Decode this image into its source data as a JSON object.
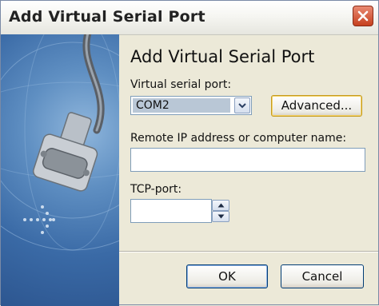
{
  "window": {
    "title": "Add Virtual Serial Port"
  },
  "dialog": {
    "heading": "Add Virtual Serial Port",
    "virtual_port_label": "Virtual serial port:",
    "virtual_port_value": "COM2",
    "advanced_button": "Advanced...",
    "remote_label": "Remote IP address or computer name:",
    "remote_value": "",
    "tcp_label": "TCP-port:",
    "tcp_value": "",
    "ok_button": "OK",
    "cancel_button": "Cancel"
  },
  "icons": {
    "close": "close-icon",
    "dropdown": "chevron-down-icon",
    "spin_up": "spin-up-icon",
    "spin_down": "spin-down-icon"
  },
  "colors": {
    "close_button": "#d55a3a",
    "banner_blue": "#3a6aa6",
    "default_button_border": "#003c74",
    "advanced_button_highlight": "#f5d46a"
  }
}
